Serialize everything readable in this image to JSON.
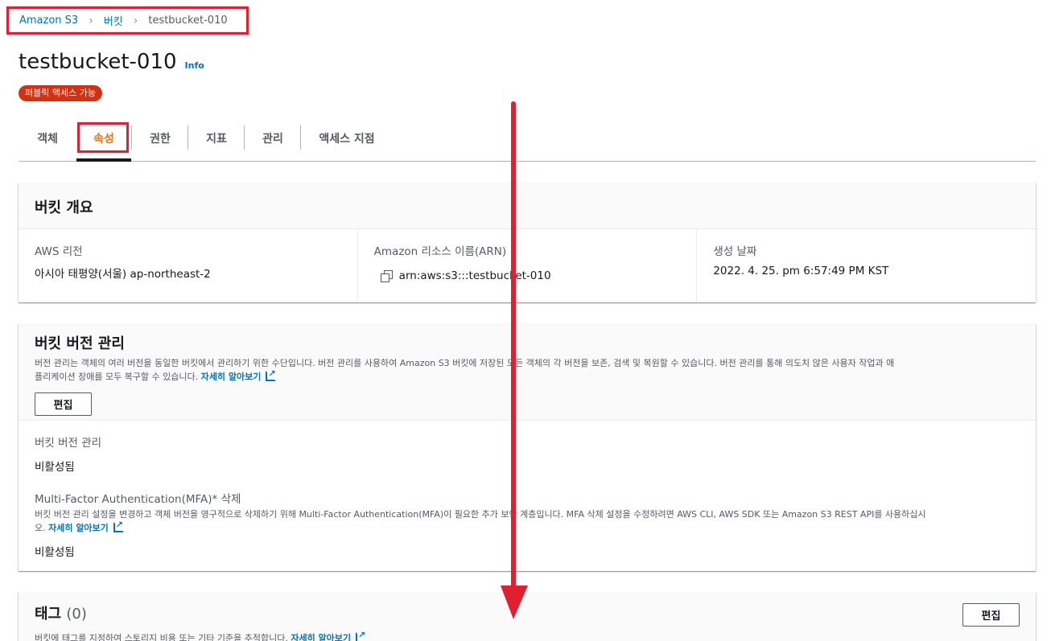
{
  "breadcrumb": {
    "root": "Amazon S3",
    "middle": "버킷",
    "current": "testbucket-010"
  },
  "header": {
    "title": "testbucket-010",
    "info": "Info",
    "badge": "퍼블릭 액세스 가능"
  },
  "tabs": [
    "객체",
    "속성",
    "권한",
    "지표",
    "관리",
    "액세스 지점"
  ],
  "overview": {
    "title": "버킷 개요",
    "region_label": "AWS 리전",
    "region_value": "아시아 태평양(서울) ap-northeast-2",
    "arn_label": "Amazon 리소스 이름(ARN)",
    "arn_value": "arn:aws:s3:::testbucket-010",
    "created_label": "생성 날짜",
    "created_value": "2022. 4. 25. pm 6:57:49 PM KST"
  },
  "versioning": {
    "title": "버킷 버전 관리",
    "desc_line1": "버전 관리는 객체의 여러 버전을 동일한 버킷에서 관리하기 위한 수단입니다. 버전 관리를 사용하여 Amazon S3 버킷에 저장된 모든 객체의 각 버전을 보존, 검색 및 복원할 수 있습니다. 버전 관리를 통해 의도치 않은 사용자 작업과 애",
    "desc_line2": "플리케이션 장애를 모두 복구할 수 있습니다.",
    "learn_more": "자세히 알아보기",
    "edit": "편집",
    "status_label": "버킷 버전 관리",
    "status_value": "비활성됨",
    "mfa_label": "Multi-Factor Authentication(MFA)* 삭제",
    "mfa_desc_line1": "버킷 버전 관리 설정을 변경하고 객체 버전을 영구적으로 삭제하기 위해 Multi-Factor Authentication(MFA)이 필요한 추가 보안 계층입니다. MFA 삭제 설정을 수정하려면 AWS CLI, AWS SDK 또는 Amazon S3 REST API를 사용하십시",
    "mfa_desc_line2": "오.",
    "mfa_learn_more": "자세히 알아보기",
    "mfa_value": "비활성됨"
  },
  "tags": {
    "title": "태그",
    "count": "(0)",
    "desc": "버킷에 태그를 지정하여 스토리지 비용 또는 기타 기준을 추적합니다.",
    "learn_more": "자세히 알아보기",
    "edit": "편집"
  },
  "colors": {
    "accent_link": "#0073bb",
    "highlight": "#e0202e",
    "badge": "#d13212",
    "active_tab": "#ec7211"
  }
}
